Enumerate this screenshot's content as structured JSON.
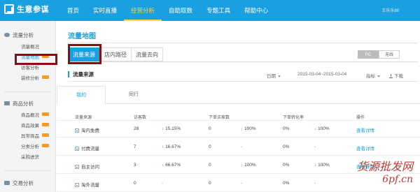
{
  "app": {
    "name": "生意参谋"
  },
  "nav": {
    "items": [
      {
        "label": "首页"
      },
      {
        "label": "实时直播"
      },
      {
        "label": "经营分析",
        "active": true
      },
      {
        "label": "自助取数"
      },
      {
        "label": "专题工具"
      },
      {
        "label": "帮助中心"
      }
    ],
    "user": "王乐乐88"
  },
  "sidebar": {
    "traffic": {
      "head": "流量分析",
      "items": [
        {
          "label": "流量概况"
        },
        {
          "label": "流量地图",
          "active": true,
          "tag": true
        },
        {
          "label": "访客分析"
        },
        {
          "label": "装修分析",
          "tag": true
        }
      ]
    },
    "product": {
      "head": "商品分析",
      "items": [
        {
          "label": "商品概况",
          "tag": true
        },
        {
          "label": "商品效果",
          "tag": true
        },
        {
          "label": "异常商品",
          "tag": true
        },
        {
          "label": "分类分析",
          "tag": true
        },
        {
          "label": "采购进货"
        }
      ]
    },
    "trade": {
      "head": "交易分析"
    }
  },
  "main": {
    "title": "流量地图",
    "tabs": [
      {
        "label": "流量来源",
        "active": true
      },
      {
        "label": "店内路径"
      },
      {
        "label": "流量去向"
      }
    ],
    "device": {
      "pc": "PC",
      "wireless": "无线"
    },
    "section_title": "流量来源",
    "filters": {
      "date_label": "日期",
      "date_range": "2015-03-04~2015-03-04",
      "metric": "指标",
      "download": "下载"
    },
    "subtabs": [
      {
        "label": "我的",
        "active": true
      },
      {
        "label": "同行"
      }
    ],
    "table": {
      "headers": [
        "流量来源",
        "访客数",
        "下单买家数",
        "下单转化率",
        "操作"
      ],
      "rows": [
        {
          "source": "淘内免费",
          "visitors": "28",
          "visitors_change": "15.15%",
          "visitors_dir": "down",
          "buyers": "0",
          "buyers_change": "100%",
          "buyers_dir": "down",
          "rate": "0%",
          "rate_change": "100%",
          "rate_dir": "down",
          "action": "查看详情"
        },
        {
          "source": "付费流量",
          "visitors": "7",
          "visitors_change": "16.67%",
          "visitors_dir": "up",
          "buyers": "0",
          "buyers_change": "-",
          "buyers_dir": "none",
          "rate": "0%",
          "rate_change": "-",
          "rate_dir": "none",
          "action": "查看详情"
        },
        {
          "source": "自主访问",
          "visitors": "3",
          "visitors_change": "66.67%",
          "visitors_dir": "down",
          "buyers": "0",
          "buyers_change": "100%",
          "buyers_dir": "down",
          "rate": "0%",
          "rate_change": "100%",
          "rate_dir": "down",
          "action": "查看详情"
        },
        {
          "source": "淘外流量",
          "visitors": "0",
          "visitors_change": "-",
          "visitors_dir": "none",
          "buyers": "0",
          "buyers_change": "-",
          "buyers_dir": "none",
          "rate": "0%",
          "rate_change": "-",
          "rate_dir": "none",
          "action": ""
        }
      ]
    }
  },
  "watermark": {
    "line1": "货源批发网",
    "line2": "6pf.cn"
  },
  "colors": {
    "brand": "#1a9fe0",
    "highlight": "#8b0e10",
    "up": "#d93a2c",
    "down": "#2ea04a"
  }
}
